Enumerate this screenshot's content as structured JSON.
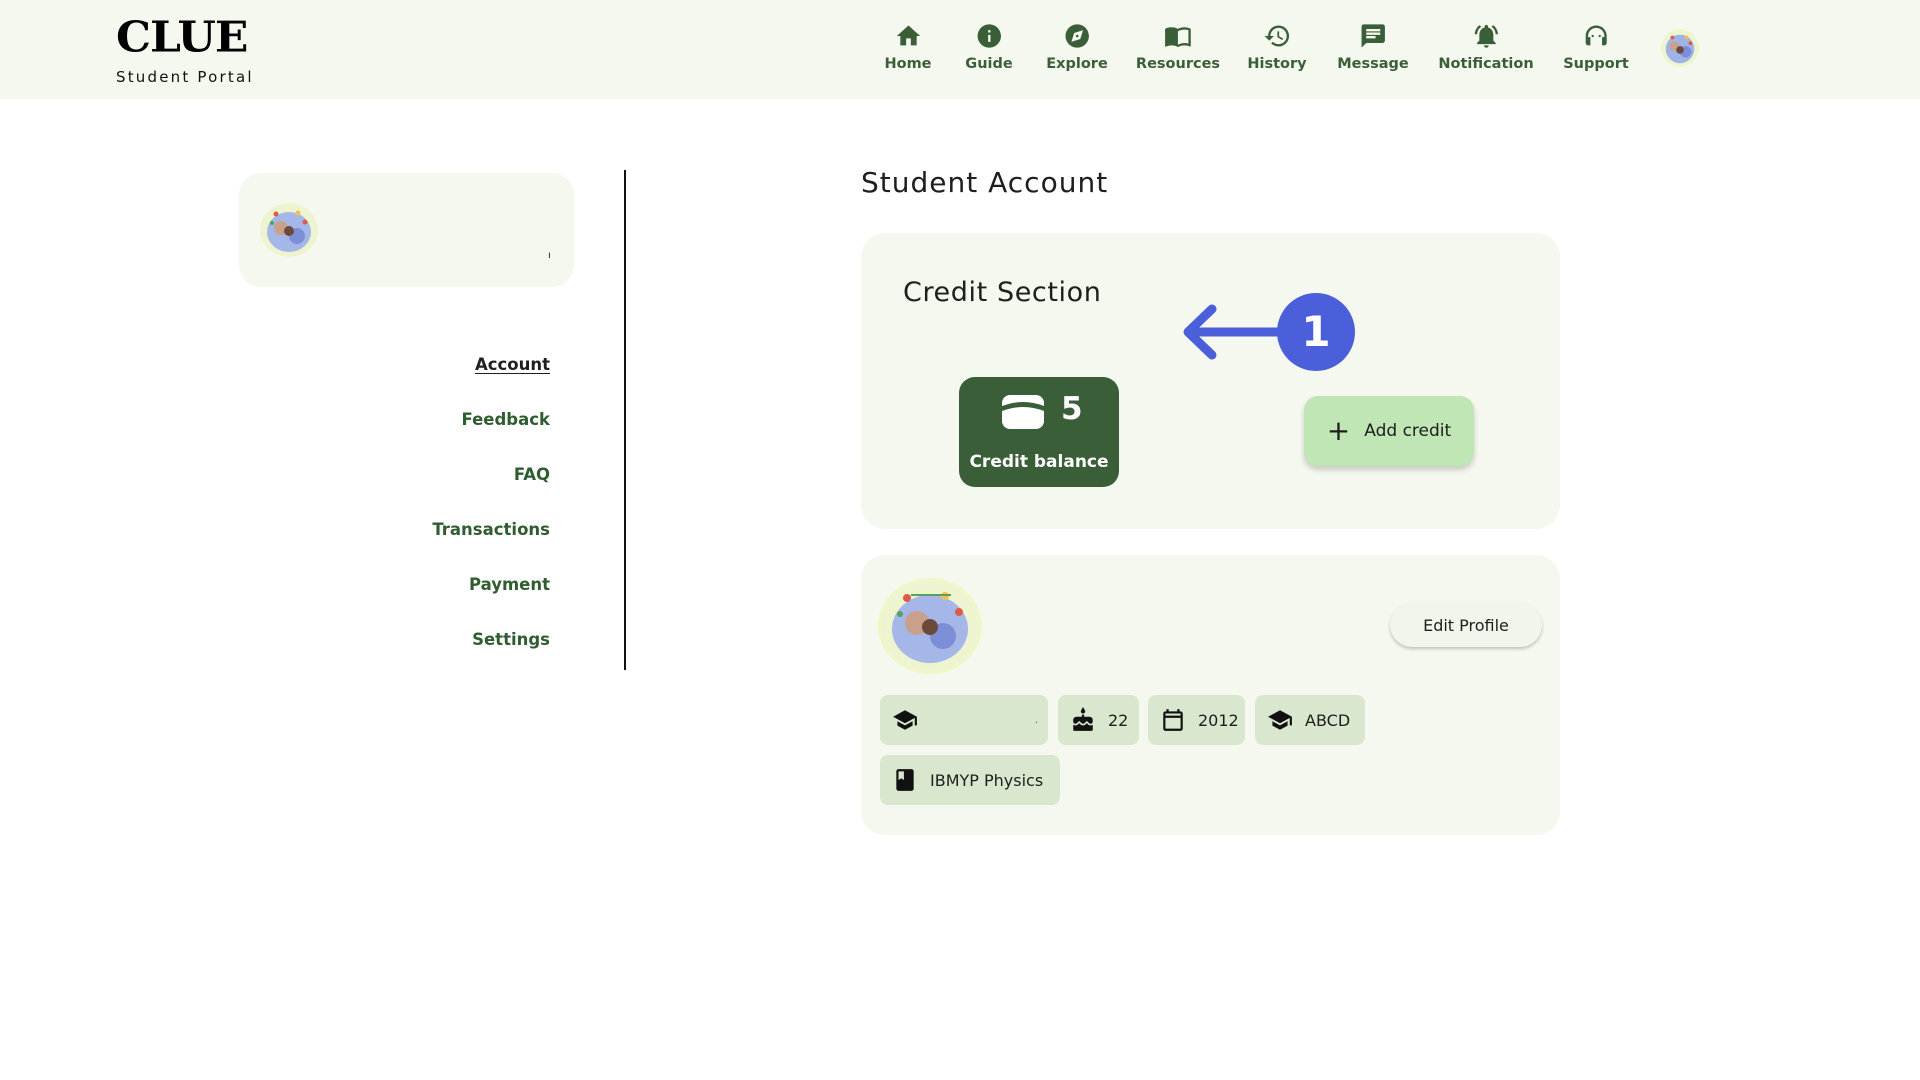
{
  "brand": {
    "logo": "CLUE",
    "subtitle": "Student Portal"
  },
  "nav": [
    {
      "label": "Home",
      "icon": "home-icon"
    },
    {
      "label": "Guide",
      "icon": "info-icon"
    },
    {
      "label": "Explore",
      "icon": "compass-icon"
    },
    {
      "label": "Resources",
      "icon": "book-open-icon"
    },
    {
      "label": "History",
      "icon": "history-icon"
    },
    {
      "label": "Message",
      "icon": "message-icon"
    },
    {
      "label": "Notification",
      "icon": "bell-icon"
    },
    {
      "label": "Support",
      "icon": "headset-icon"
    }
  ],
  "sidebar": {
    "profile_tag": "ı",
    "items": [
      {
        "label": "Account",
        "active": true
      },
      {
        "label": "Feedback",
        "active": false
      },
      {
        "label": "FAQ",
        "active": false
      },
      {
        "label": "Transactions",
        "active": false
      },
      {
        "label": "Payment",
        "active": false
      },
      {
        "label": "Settings",
        "active": false
      }
    ]
  },
  "main": {
    "page_title": "Student Account",
    "credit": {
      "title": "Credit Section",
      "balance_value": "5",
      "balance_label": "Credit balance",
      "add_button": "Add credit",
      "add_icon": "+"
    },
    "annotation": {
      "number": "1",
      "color": "#4a5fd9"
    },
    "profile": {
      "edit_button": "Edit Profile",
      "chips": [
        {
          "icon": "graduation-cap-icon",
          "text": "",
          "dot": "."
        },
        {
          "icon": "cake-icon",
          "text": "22"
        },
        {
          "icon": "calendar-icon",
          "text": "2012"
        },
        {
          "icon": "graduation-cap-icon",
          "text": "ABCD"
        },
        {
          "icon": "book-icon",
          "text": "IBMYP Physics"
        }
      ]
    }
  },
  "colors": {
    "primary_green": "#3a5e38",
    "panel_bg": "#f5f8ee",
    "chip_bg": "#d8e7cd",
    "add_button_bg": "#bfe6b4",
    "annotation_blue": "#4a5fd9"
  }
}
